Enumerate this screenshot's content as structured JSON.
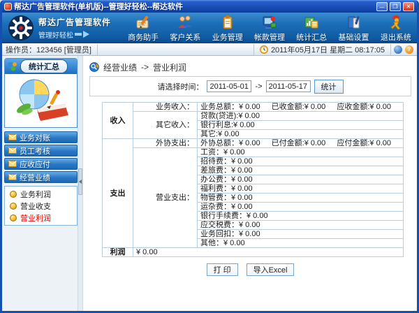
{
  "window": {
    "title": "帮达广告管理软件(单机版)--管理好轻松--帮达软件"
  },
  "brand": {
    "name": "帮达广告管理软件",
    "slogan": "管理好轻松"
  },
  "nav": {
    "items": [
      {
        "label": "商务助手",
        "icon": "notepad-pencil-icon"
      },
      {
        "label": "客户关系",
        "icon": "people-icon"
      },
      {
        "label": "业务管理",
        "icon": "clipboard-icon"
      },
      {
        "label": "帐款管理",
        "icon": "computer-icon"
      },
      {
        "label": "统计汇总",
        "icon": "chart-folder-icon"
      },
      {
        "label": "基础设置",
        "icon": "books-icon"
      },
      {
        "label": "退出系统",
        "icon": "exit-runner-icon"
      }
    ]
  },
  "operator_bar": {
    "operator": "操作员：123456 [管理员]",
    "datetime": "2011年05月17日 星期二 08:17:05"
  },
  "sidebar": {
    "header": "统计汇总",
    "menu": [
      {
        "label": "业务对账"
      },
      {
        "label": "员工考核"
      },
      {
        "label": "应收应付"
      },
      {
        "label": "经营业绩"
      }
    ],
    "submenu": [
      {
        "label": "业务利润",
        "active": false
      },
      {
        "label": "营业收支",
        "active": false
      },
      {
        "label": "营业利润",
        "active": true
      }
    ]
  },
  "main": {
    "breadcrumb": {
      "section": "经营业绩",
      "separator": "->",
      "page": "营业利润"
    },
    "filter": {
      "label": "请选择时间：",
      "date_from": "2011-05-01",
      "arrow": "->",
      "date_to": "2011-05-17",
      "submit_label": "统计"
    },
    "table": {
      "income_group": "收入",
      "expense_group": "支出",
      "profit_group": "利润",
      "business_income": {
        "label": "业务收入：",
        "parts": [
          "业务总额：¥ 0.00",
          "已收金额:¥ 0.00",
          "应收金额:¥ 0.00"
        ]
      },
      "other_income": {
        "label": "其它收入：",
        "items": [
          "贷款(贷进):¥ 0.00",
          "银行利息:¥ 0.00",
          "其它:¥ 0.00"
        ]
      },
      "outsource": {
        "label": "外协支出：",
        "parts": [
          "外协总额：¥ 0.00",
          "已付金额:¥ 0.00",
          "应付金额:¥ 0.00"
        ]
      },
      "operating": {
        "label": "营业支出：",
        "items": [
          "工资：¥ 0.00",
          "招待费：¥ 0.00",
          "差旅费：¥ 0.00",
          "办公费：¥ 0.00",
          "福利费：¥ 0.00",
          "物管费：¥ 0.00",
          "运杂费：¥ 0.00",
          "银行手续费：¥ 0.00",
          "应交税费：¥ 0.00",
          "业务回扣：¥ 0.00",
          "其他：¥ 0.00"
        ]
      },
      "profit_value": "¥ 0.00"
    },
    "actions": {
      "print": "打 印",
      "export": "导入Excel"
    }
  },
  "colors": {
    "titlebar_blue": "#1b4fba",
    "nav_blue": "#1d6fb9",
    "sidebar_item_blue": "#2a77c4",
    "active_item_red": "#e00000",
    "table_border": "#b9cfe0"
  }
}
